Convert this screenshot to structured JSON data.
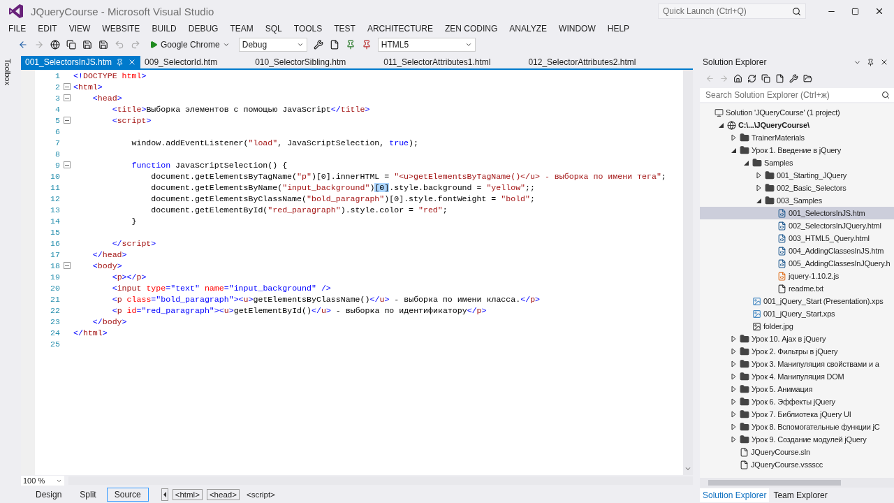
{
  "window": {
    "title": "JQueryCourse - Microsoft Visual Studio",
    "quick_launch": {
      "placeholder": "Quick Launch (Ctrl+Q)"
    }
  },
  "menu": [
    "FILE",
    "EDIT",
    "VIEW",
    "WEBSITE",
    "BUILD",
    "DEBUG",
    "TEAM",
    "SQL",
    "TOOLS",
    "TEST",
    "ARCHITECTURE",
    "ZEN CODING",
    "ANALYZE",
    "WINDOW",
    "HELP"
  ],
  "toolbar": {
    "run_target": "Google Chrome",
    "configuration": "Debug",
    "target_schema": "HTML5"
  },
  "side_strip": "Toolbox",
  "tabs": [
    {
      "label": "001_SelectorsInJS.htm",
      "selected": true
    },
    {
      "label": "009_SelectorId.htm",
      "selected": false
    },
    {
      "label": "010_SelectorSibling.htm",
      "selected": false
    },
    {
      "label": "011_SelectorAttributes1.html",
      "selected": false
    },
    {
      "label": "012_SelectorAttributes2.html",
      "selected": false
    }
  ],
  "editor": {
    "lines": [
      {
        "n": "1",
        "fold": false,
        "tokens": [
          {
            "kind": "punct",
            "text": "<!"
          },
          {
            "kind": "tag",
            "text": "DOCTYPE"
          },
          {
            "kind": "attr",
            "text": " html"
          },
          {
            "kind": "punct",
            "text": ">"
          }
        ]
      },
      {
        "n": "2",
        "fold": true,
        "tokens": [
          {
            "kind": "punct",
            "text": "<"
          },
          {
            "kind": "tag",
            "text": "html"
          },
          {
            "kind": "punct",
            "text": ">"
          }
        ]
      },
      {
        "n": "3",
        "fold": true,
        "tokens": [
          {
            "kind": "punct",
            "text": "    <"
          },
          {
            "kind": "tag",
            "text": "head"
          },
          {
            "kind": "punct",
            "text": ">"
          }
        ]
      },
      {
        "n": "4",
        "fold": false,
        "tokens": [
          {
            "kind": "punct",
            "text": "        <"
          },
          {
            "kind": "tag",
            "text": "title"
          },
          {
            "kind": "punct",
            "text": ">"
          },
          {
            "kind": "plain",
            "text": "Выборка элементов с помощью JavaScript"
          },
          {
            "kind": "punct",
            "text": "</"
          },
          {
            "kind": "tag",
            "text": "title"
          },
          {
            "kind": "punct",
            "text": ">"
          }
        ]
      },
      {
        "n": "5",
        "fold": true,
        "tokens": [
          {
            "kind": "punct",
            "text": "        <"
          },
          {
            "kind": "tag",
            "text": "script"
          },
          {
            "kind": "punct",
            "text": ">"
          }
        ]
      },
      {
        "n": "6",
        "fold": false
      },
      {
        "n": "7",
        "fold": false,
        "tokens": [
          {
            "kind": "plain",
            "text": "            window.addEventListener("
          },
          {
            "kind": "string",
            "text": "\"load\""
          },
          {
            "kind": "plain",
            "text": ", JavaScriptSelection, "
          },
          {
            "kind": "keyword",
            "text": "true"
          },
          {
            "kind": "plain",
            "text": ");"
          }
        ]
      },
      {
        "n": "8",
        "fold": false
      },
      {
        "n": "9",
        "fold": true,
        "tokens": [
          {
            "kind": "keyword",
            "text": "            function"
          },
          {
            "kind": "plain",
            "text": " JavaScriptSelection() {"
          }
        ]
      },
      {
        "n": "10",
        "fold": false,
        "tokens": [
          {
            "kind": "plain",
            "text": "                document.getElementsByTagName("
          },
          {
            "kind": "string",
            "text": "\"p\""
          },
          {
            "kind": "plain",
            "text": ")[0].innerHTML = "
          },
          {
            "kind": "string",
            "text": "\"<u>getElementsByTagName()</u> - выборка по имени тега\""
          },
          {
            "kind": "plain",
            "text": ";"
          }
        ]
      },
      {
        "n": "11",
        "fold": false,
        "tokens": [
          {
            "kind": "plain",
            "text": "                document.getElementsByName("
          },
          {
            "kind": "string",
            "text": "\"input_background\""
          },
          {
            "kind": "plain",
            "text": ")"
          },
          {
            "kind": "highlight",
            "text": "[0]"
          },
          {
            "kind": "plain",
            "text": ".style.background = "
          },
          {
            "kind": "string",
            "text": "\"yellow\""
          },
          {
            "kind": "plain",
            "text": ";;"
          }
        ]
      },
      {
        "n": "12",
        "fold": false,
        "tokens": [
          {
            "kind": "plain",
            "text": "                document.getElementsByClassName("
          },
          {
            "kind": "string",
            "text": "\"bold_paragraph\""
          },
          {
            "kind": "plain",
            "text": ")[0].style.fontWeight = "
          },
          {
            "kind": "string",
            "text": "\"bold\""
          },
          {
            "kind": "plain",
            "text": ";"
          }
        ]
      },
      {
        "n": "13",
        "fold": false,
        "tokens": [
          {
            "kind": "plain",
            "text": "                document.getElementById("
          },
          {
            "kind": "string",
            "text": "\"red_paragraph\""
          },
          {
            "kind": "plain",
            "text": ").style.color = "
          },
          {
            "kind": "string",
            "text": "\"red\""
          },
          {
            "kind": "plain",
            "text": ";"
          }
        ]
      },
      {
        "n": "14",
        "fold": false,
        "tokens": [
          {
            "kind": "plain",
            "text": "            }"
          }
        ]
      },
      {
        "n": "15",
        "fold": false
      },
      {
        "n": "16",
        "fold": false,
        "tokens": [
          {
            "kind": "punct",
            "text": "        </"
          },
          {
            "kind": "tag",
            "text": "script"
          },
          {
            "kind": "punct",
            "text": ">"
          }
        ]
      },
      {
        "n": "17",
        "fold": false,
        "tokens": [
          {
            "kind": "punct",
            "text": "    </"
          },
          {
            "kind": "tag",
            "text": "head"
          },
          {
            "kind": "punct",
            "text": ">"
          }
        ]
      },
      {
        "n": "18",
        "fold": true,
        "tokens": [
          {
            "kind": "punct",
            "text": "    <"
          },
          {
            "kind": "tag",
            "text": "body"
          },
          {
            "kind": "punct",
            "text": ">"
          }
        ]
      },
      {
        "n": "19",
        "fold": false,
        "tokens": [
          {
            "kind": "punct",
            "text": "        <"
          },
          {
            "kind": "tag",
            "text": "p"
          },
          {
            "kind": "punct",
            "text": "></"
          },
          {
            "kind": "tag",
            "text": "p"
          },
          {
            "kind": "punct",
            "text": ">"
          }
        ]
      },
      {
        "n": "20",
        "fold": false,
        "tokens": [
          {
            "kind": "punct",
            "text": "        <"
          },
          {
            "kind": "tag",
            "text": "input"
          },
          {
            "kind": "attr",
            "text": " type"
          },
          {
            "kind": "punct",
            "text": "="
          },
          {
            "kind": "value",
            "text": "\"text\""
          },
          {
            "kind": "attr",
            "text": " name"
          },
          {
            "kind": "punct",
            "text": "="
          },
          {
            "kind": "value",
            "text": "\"input_background\""
          },
          {
            "kind": "punct",
            "text": " />"
          }
        ]
      },
      {
        "n": "21",
        "fold": false,
        "tokens": [
          {
            "kind": "punct",
            "text": "        <"
          },
          {
            "kind": "tag",
            "text": "p"
          },
          {
            "kind": "attr",
            "text": " class"
          },
          {
            "kind": "punct",
            "text": "="
          },
          {
            "kind": "value",
            "text": "\"bold_paragraph\""
          },
          {
            "kind": "punct",
            "text": "><"
          },
          {
            "kind": "tag",
            "text": "u"
          },
          {
            "kind": "punct",
            "text": ">"
          },
          {
            "kind": "plain",
            "text": "getElementsByClassName()"
          },
          {
            "kind": "punct",
            "text": "</"
          },
          {
            "kind": "tag",
            "text": "u"
          },
          {
            "kind": "punct",
            "text": ">"
          },
          {
            "kind": "plain",
            "text": " - выборка по имени класса."
          },
          {
            "kind": "punct",
            "text": "</"
          },
          {
            "kind": "tag",
            "text": "p"
          },
          {
            "kind": "punct",
            "text": ">"
          }
        ]
      },
      {
        "n": "22",
        "fold": false,
        "tokens": [
          {
            "kind": "punct",
            "text": "        <"
          },
          {
            "kind": "tag",
            "text": "p"
          },
          {
            "kind": "attr",
            "text": " id"
          },
          {
            "kind": "punct",
            "text": "="
          },
          {
            "kind": "value",
            "text": "\"red_paragraph\""
          },
          {
            "kind": "punct",
            "text": "><"
          },
          {
            "kind": "tag",
            "text": "u"
          },
          {
            "kind": "punct",
            "text": ">"
          },
          {
            "kind": "plain",
            "text": "getElementById()"
          },
          {
            "kind": "punct",
            "text": "</"
          },
          {
            "kind": "tag",
            "text": "u"
          },
          {
            "kind": "punct",
            "text": ">"
          },
          {
            "kind": "plain",
            "text": " - выборка по идентификатору"
          },
          {
            "kind": "punct",
            "text": "</"
          },
          {
            "kind": "tag",
            "text": "p"
          },
          {
            "kind": "punct",
            "text": ">"
          }
        ]
      },
      {
        "n": "23",
        "fold": false,
        "tokens": [
          {
            "kind": "punct",
            "text": "    </"
          },
          {
            "kind": "tag",
            "text": "body"
          },
          {
            "kind": "punct",
            "text": ">"
          }
        ]
      },
      {
        "n": "24",
        "fold": false,
        "tokens": [
          {
            "kind": "punct",
            "text": "</"
          },
          {
            "kind": "tag",
            "text": "html"
          },
          {
            "kind": "punct",
            "text": ">"
          }
        ]
      },
      {
        "n": "25",
        "fold": false
      }
    ],
    "zoom": "100 %"
  },
  "view_buttons": [
    {
      "label": "Design",
      "selected": false
    },
    {
      "label": "Split",
      "selected": false
    },
    {
      "label": "Source",
      "selected": true
    }
  ],
  "breadcrumb": [
    {
      "label": "<html>",
      "current": false
    },
    {
      "label": "<head>",
      "current": false
    },
    {
      "label": "<script>",
      "current": true
    }
  ],
  "solution_explorer": {
    "title": "Solution Explorer",
    "search": {
      "placeholder": "Search Solution Explorer (Ctrl+ж)"
    },
    "tree": [
      {
        "label": "Solution 'JQueryCourse' (1 project)",
        "kind": "solution",
        "selected": false,
        "children": [
          {
            "label": "C:\\...\\JQueryCourse\\",
            "kind": "project",
            "expanded": true,
            "selected": false,
            "children": [
              {
                "label": "TrainerMaterials",
                "kind": "folder",
                "expanded": false,
                "selected": false
              },
              {
                "label": "Урок 1. Введение в jQuery",
                "kind": "folder",
                "expanded": true,
                "selected": false,
                "children": [
                  {
                    "label": "Samples",
                    "kind": "folder",
                    "expanded": true,
                    "selected": false,
                    "children": [
                      {
                        "label": "001_Starting_JQuery",
                        "kind": "folder",
                        "expanded": false,
                        "selected": false
                      },
                      {
                        "label": "002_Basic_Selectors",
                        "kind": "folder",
                        "expanded": false,
                        "selected": false
                      },
                      {
                        "label": "003_Samples",
                        "kind": "folder",
                        "expanded": true,
                        "selected": false,
                        "children": [
                          {
                            "label": "001_SelectorsInJS.htm",
                            "kind": "html",
                            "selected": true
                          },
                          {
                            "label": "002_SelectorsInJQuery.html",
                            "kind": "html",
                            "selected": false
                          },
                          {
                            "label": "003_HTML5_Query.html",
                            "kind": "html",
                            "selected": false
                          },
                          {
                            "label": "004_AddingClassesInJS.htm",
                            "kind": "html",
                            "selected": false
                          },
                          {
                            "label": "005_AddingClassesInJQuery.h",
                            "kind": "html",
                            "selected": false
                          },
                          {
                            "label": "jquery-1.10.2.js",
                            "kind": "js",
                            "selected": false
                          },
                          {
                            "label": "readme.txt",
                            "kind": "file",
                            "selected": false
                          }
                        ]
                      }
                    ]
                  },
                  {
                    "label": "001_jQuery_Start (Presentation).xps",
                    "kind": "xps",
                    "selected": false
                  },
                  {
                    "label": "001_jQuery_Start.xps",
                    "kind": "xps",
                    "selected": false
                  },
                  {
                    "label": "folder.jpg",
                    "kind": "image",
                    "selected": false
                  }
                ]
              },
              {
                "label": "Урок 10. Ajax в jQuery",
                "kind": "folder",
                "expanded": false,
                "selected": false
              },
              {
                "label": "Урок 2. Фильтры в jQuery",
                "kind": "folder",
                "expanded": false,
                "selected": false
              },
              {
                "label": "Урок 3. Манипуляция свойствами и а",
                "kind": "folder",
                "expanded": false,
                "selected": false
              },
              {
                "label": "Урок 4. Манипуляция DOM",
                "kind": "folder",
                "expanded": false,
                "selected": false
              },
              {
                "label": "Урок 5. Анимация",
                "kind": "folder",
                "expanded": false,
                "selected": false
              },
              {
                "label": "Урок 6. Эффекты jQuery",
                "kind": "folder",
                "expanded": false,
                "selected": false
              },
              {
                "label": "Урок 7. Библиотека jQuery UI",
                "kind": "folder",
                "expanded": false,
                "selected": false
              },
              {
                "label": "Урок 8. Вспомогательные функции jC",
                "kind": "folder",
                "expanded": false,
                "selected": false
              },
              {
                "label": "Урок 9. Создание модулей jQuery",
                "kind": "folder",
                "expanded": false,
                "selected": false
              },
              {
                "label": "JQueryCourse.sln",
                "kind": "file",
                "selected": false
              },
              {
                "label": "JQueryCourse.vssscc",
                "kind": "file",
                "selected": false
              }
            ]
          }
        ]
      }
    ],
    "bottom_tabs": [
      {
        "label": "Solution Explorer",
        "selected": true
      },
      {
        "label": "Team Explorer",
        "selected": false
      }
    ]
  }
}
